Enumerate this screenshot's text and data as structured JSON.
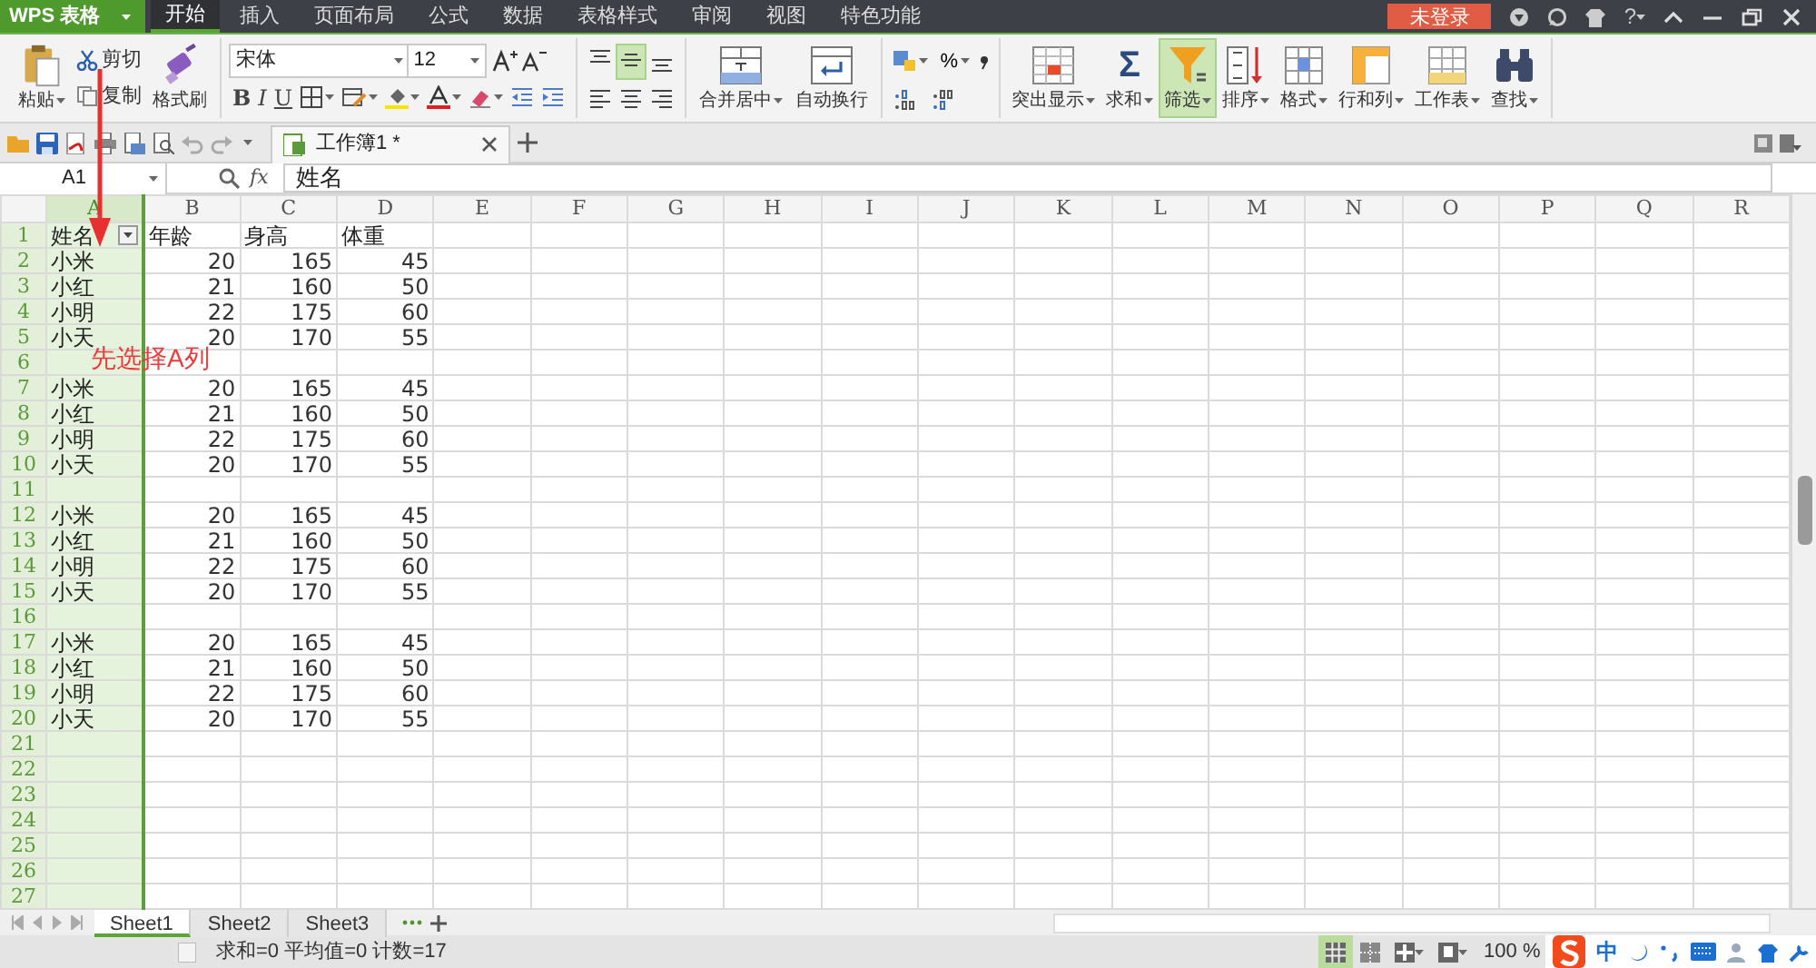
{
  "app_menu": {
    "label": "WPS 表格"
  },
  "menu_tabs": [
    {
      "label": "开始",
      "selected": true
    },
    {
      "label": "插入",
      "selected": false
    },
    {
      "label": "页面布局",
      "selected": false
    },
    {
      "label": "公式",
      "selected": false
    },
    {
      "label": "数据",
      "selected": false
    },
    {
      "label": "表格样式",
      "selected": false
    },
    {
      "label": "审阅",
      "selected": false
    },
    {
      "label": "视图",
      "selected": false
    },
    {
      "label": "特色功能",
      "selected": false
    }
  ],
  "login_button": {
    "label": "未登录"
  },
  "help_button": {
    "label": "?"
  },
  "ribbon": {
    "paste": {
      "label": "粘贴"
    },
    "cut": {
      "label": "剪切"
    },
    "copy": {
      "label": "复制"
    },
    "format_painter": {
      "label": "格式刷"
    },
    "font_name": "宋体",
    "font_size": "12",
    "font_styles": [
      "B",
      "I",
      "U"
    ],
    "vertical_align": [
      {
        "selected": false
      },
      {
        "selected": true
      },
      {
        "selected": false
      }
    ],
    "merge": {
      "label": "合并居中"
    },
    "wrap": {
      "label": "自动换行"
    },
    "percent": {
      "label": "%"
    },
    "tools": [
      {
        "label": "突出显示",
        "selected": false
      },
      {
        "label": "求和",
        "selected": false,
        "icon_text": "Σ"
      },
      {
        "label": "筛选",
        "selected": true
      },
      {
        "label": "排序",
        "selected": false
      },
      {
        "label": "格式",
        "selected": false
      },
      {
        "label": "行和列",
        "selected": false
      },
      {
        "label": "工作表",
        "selected": false
      },
      {
        "label": "查找",
        "selected": false
      }
    ]
  },
  "document_tab": {
    "title": "工作簿1 *"
  },
  "formula_bar": {
    "cell_ref": "A1",
    "fx": "fx",
    "value": "姓名"
  },
  "sheet": {
    "columns": [
      {
        "label": "A",
        "selected": true
      },
      {
        "label": "B",
        "selected": false
      },
      {
        "label": "C",
        "selected": false
      },
      {
        "label": "D",
        "selected": false
      },
      {
        "label": "E",
        "selected": false
      },
      {
        "label": "F",
        "selected": false
      },
      {
        "label": "G",
        "selected": false
      },
      {
        "label": "H",
        "selected": false
      },
      {
        "label": "I",
        "selected": false
      },
      {
        "label": "J",
        "selected": false
      },
      {
        "label": "K",
        "selected": false
      },
      {
        "label": "L",
        "selected": false
      },
      {
        "label": "M",
        "selected": false
      },
      {
        "label": "N",
        "selected": false
      },
      {
        "label": "O",
        "selected": false
      },
      {
        "label": "P",
        "selected": false
      },
      {
        "label": "Q",
        "selected": false
      },
      {
        "label": "R",
        "selected": false
      }
    ],
    "rows": [
      {
        "number": "1",
        "kind": "header",
        "cells": [
          "姓名",
          "年龄",
          "身高",
          "体重"
        ]
      },
      {
        "number": "2",
        "kind": "data",
        "cells": [
          "小米",
          "20",
          "165",
          "45"
        ]
      },
      {
        "number": "3",
        "kind": "data",
        "cells": [
          "小红",
          "21",
          "160",
          "50"
        ]
      },
      {
        "number": "4",
        "kind": "data",
        "cells": [
          "小明",
          "22",
          "175",
          "60"
        ]
      },
      {
        "number": "5",
        "kind": "data",
        "cells": [
          "小天",
          "20",
          "170",
          "55"
        ]
      },
      {
        "number": "6",
        "kind": "data"
      },
      {
        "number": "7",
        "kind": "data",
        "cells": [
          "小米",
          "20",
          "165",
          "45"
        ]
      },
      {
        "number": "8",
        "kind": "data",
        "cells": [
          "小红",
          "21",
          "160",
          "50"
        ]
      },
      {
        "number": "9",
        "kind": "data",
        "cells": [
          "小明",
          "22",
          "175",
          "60"
        ]
      },
      {
        "number": "10",
        "kind": "data",
        "cells": [
          "小天",
          "20",
          "170",
          "55"
        ]
      },
      {
        "number": "11",
        "kind": "data"
      },
      {
        "number": "12",
        "kind": "data",
        "cells": [
          "小米",
          "20",
          "165",
          "45"
        ]
      },
      {
        "number": "13",
        "kind": "data",
        "cells": [
          "小红",
          "21",
          "160",
          "50"
        ]
      },
      {
        "number": "14",
        "kind": "data",
        "cells": [
          "小明",
          "22",
          "175",
          "60"
        ]
      },
      {
        "number": "15",
        "kind": "data",
        "cells": [
          "小天",
          "20",
          "170",
          "55"
        ]
      },
      {
        "number": "16",
        "kind": "data"
      },
      {
        "number": "17",
        "kind": "data",
        "cells": [
          "小米",
          "20",
          "165",
          "45"
        ]
      },
      {
        "number": "18",
        "kind": "data",
        "cells": [
          "小红",
          "21",
          "160",
          "50"
        ]
      },
      {
        "number": "19",
        "kind": "data",
        "cells": [
          "小明",
          "22",
          "175",
          "60"
        ]
      },
      {
        "number": "20",
        "kind": "data",
        "cells": [
          "小天",
          "20",
          "170",
          "55"
        ]
      },
      {
        "number": "21",
        "kind": "data"
      },
      {
        "number": "22",
        "kind": "data"
      },
      {
        "number": "23",
        "kind": "data"
      },
      {
        "number": "24",
        "kind": "data"
      },
      {
        "number": "25",
        "kind": "data"
      },
      {
        "number": "26",
        "kind": "data"
      },
      {
        "number": "27",
        "kind": "data"
      }
    ]
  },
  "annotation": {
    "text": "先选择A列"
  },
  "sheet_tabs": [
    {
      "label": "Sheet1",
      "selected": true
    },
    {
      "label": "Sheet2",
      "selected": false
    },
    {
      "label": "Sheet3",
      "selected": false
    }
  ],
  "status_bar": {
    "summary": "求和=0 平均值=0 计数=17",
    "zoom": "100 %",
    "views": [
      {
        "selected": true
      },
      {
        "selected": false
      }
    ]
  },
  "ime": {
    "mode": "中"
  }
}
